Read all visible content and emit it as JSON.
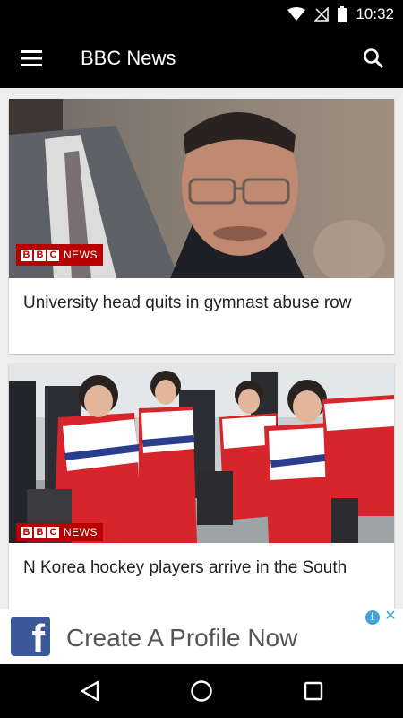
{
  "status_bar": {
    "time": "10:32",
    "icons": [
      "wifi-icon",
      "no-signal-icon",
      "battery-icon"
    ]
  },
  "app_bar": {
    "title": "BBC News",
    "menu_icon": "hamburger-menu-icon",
    "search_icon": "search-icon"
  },
  "articles": [
    {
      "headline": "University head quits in gymnast abuse row",
      "badge_blocks": [
        "B",
        "B",
        "C"
      ],
      "badge_text": "NEWS"
    },
    {
      "headline": "N Korea hockey players arrive in the South",
      "badge_blocks": [
        "B",
        "B",
        "C"
      ],
      "badge_text": "NEWS"
    }
  ],
  "ad": {
    "logo_letter": "f",
    "text": "Create A Profile Now",
    "info_label": "i",
    "close_label": "✕"
  },
  "nav_bar": {
    "icons": [
      "back-icon",
      "home-icon",
      "recent-apps-icon"
    ]
  },
  "colors": {
    "bbc_red": "#b80000",
    "facebook_blue": "#3b5998",
    "feed_background": "#eeeeee"
  }
}
